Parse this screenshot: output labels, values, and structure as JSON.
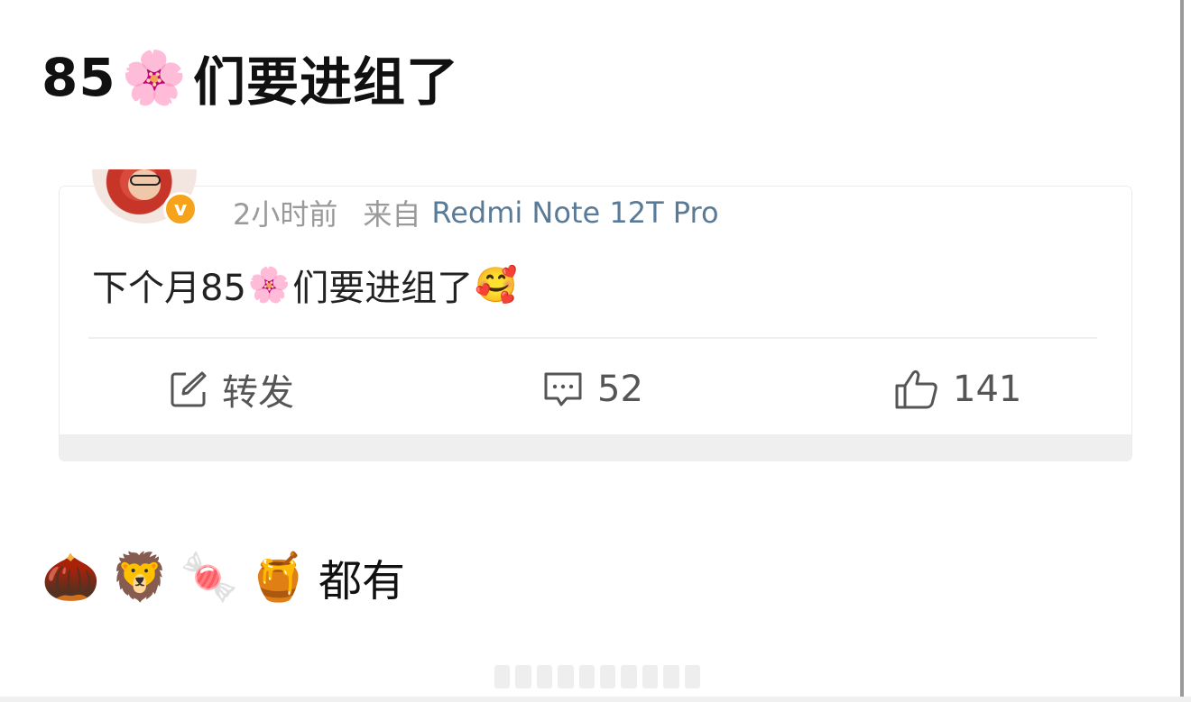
{
  "headline": {
    "prefix": "85",
    "emoji": "🌸",
    "suffix": "们要进组了"
  },
  "post": {
    "time": "2小时前",
    "from_label": "来自",
    "device": "Redmi Note 12T Pro",
    "text_before": "下个月85",
    "text_emoji": "🌸",
    "text_after": "们要进组了",
    "end_emoji": "🥰"
  },
  "actions": {
    "repost_label": "转发",
    "comment_count": "52",
    "like_count": "141"
  },
  "footer": {
    "emojis": [
      "🌰",
      "🦁",
      "🍬",
      "🍯"
    ],
    "text": "都有"
  },
  "icons": {
    "verified_badge": "v-badge-icon",
    "repost": "edit-square-icon",
    "comment": "comment-icon",
    "like": "thumbs-up-icon"
  },
  "colors": {
    "badge": "#f7a21b",
    "device_link": "#5a7b98",
    "meta_gray": "#9a9a9a"
  }
}
